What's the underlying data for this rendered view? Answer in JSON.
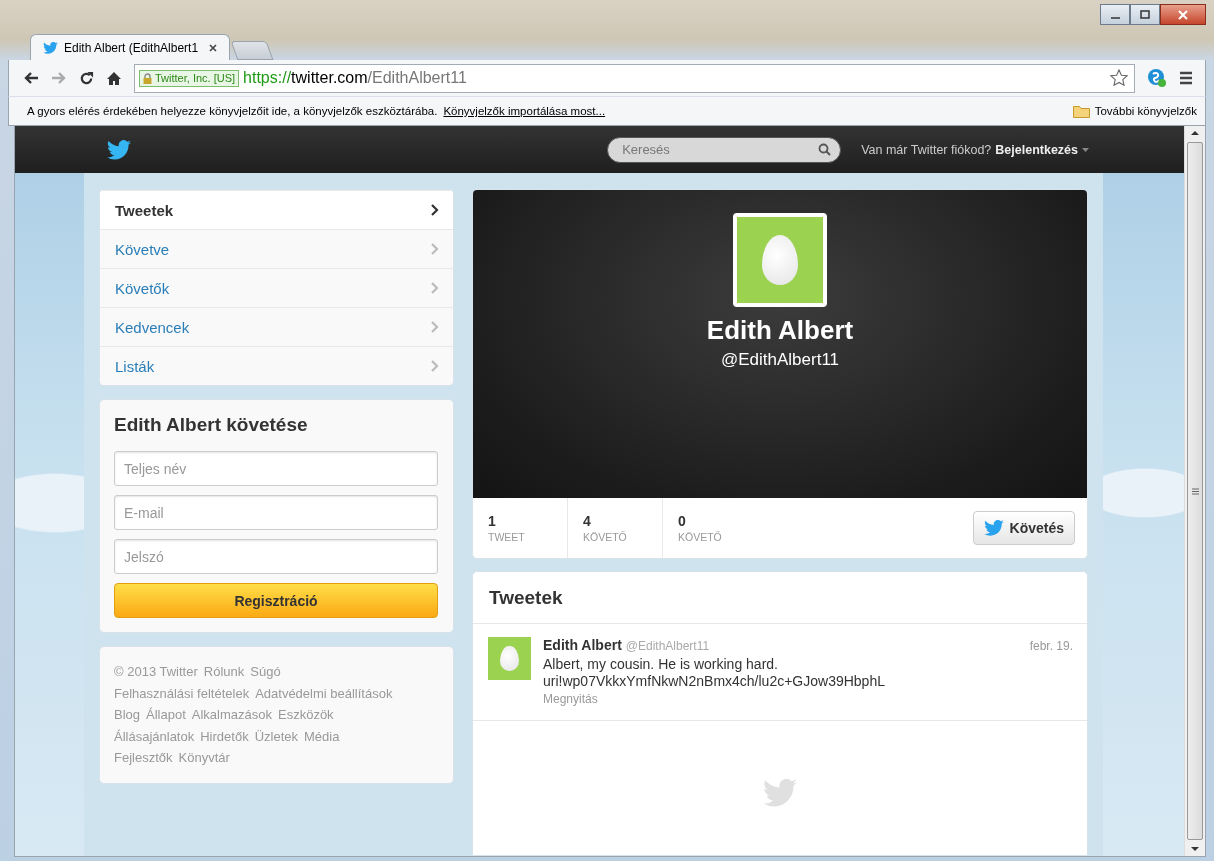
{
  "browser": {
    "tab_title": "Edith Albert (EdithAlbert1",
    "secure_label": "Twitter, Inc. [US]",
    "url_scheme": "https://",
    "url_host": "twitter.com",
    "url_path": "/EdithAlbert11",
    "bookmarks_bar": {
      "message": "A gyors elérés érdekében helyezze könyvjelzőit ide, a könyvjelzők eszköztárába.",
      "import_link": "Könyvjelzők importálása most...",
      "folder": "További könyvjelzők"
    }
  },
  "topbar": {
    "search": {
      "placeholder": "Keresés"
    },
    "login_prompt": "Van már Twitter fiókod?",
    "login_link": "Bejelentkezés"
  },
  "nav": [
    {
      "label": "Tweetek",
      "selected": true
    },
    {
      "label": "Követve",
      "selected": false
    },
    {
      "label": "Követők",
      "selected": false
    },
    {
      "label": "Kedvencek",
      "selected": false
    },
    {
      "label": "Listák",
      "selected": false
    }
  ],
  "signup": {
    "title": "Edith Albert követése",
    "fields": [
      {
        "placeholder": "Teljes név"
      },
      {
        "placeholder": "E-mail"
      },
      {
        "placeholder": "Jelszó"
      }
    ],
    "button": "Regisztráció"
  },
  "footer_links": [
    "© 2013 Twitter",
    "Rólunk",
    "Súgó",
    "Felhasználási feltételek",
    "Adatvédelmi beállítások",
    "Blog",
    "Állapot",
    "Alkalmazások",
    "Eszközök",
    "Állásajánlatok",
    "Hirdetők",
    "Üzletek",
    "Média",
    "Fejlesztők",
    "Könyvtár"
  ],
  "profile": {
    "name": "Edith Albert",
    "handle": "@EdithAlbert11"
  },
  "stats": [
    {
      "value": "1",
      "label": "TWEET"
    },
    {
      "value": "4",
      "label": "KÖVETŐ"
    },
    {
      "value": "0",
      "label": "KÖVETŐ"
    }
  ],
  "follow_button": "Követés",
  "tweets": {
    "title": "Tweetek",
    "items": [
      {
        "name": "Edith Albert",
        "handle": "@EdithAlbert11",
        "date": "febr. 19.",
        "lines": [
          "Albert, my cousin. He is working hard.",
          "uri!wp07VkkxYmfNkwN2nBmx4ch/lu2c+GJow39HbphL"
        ],
        "action": "Megnyitás"
      }
    ]
  }
}
